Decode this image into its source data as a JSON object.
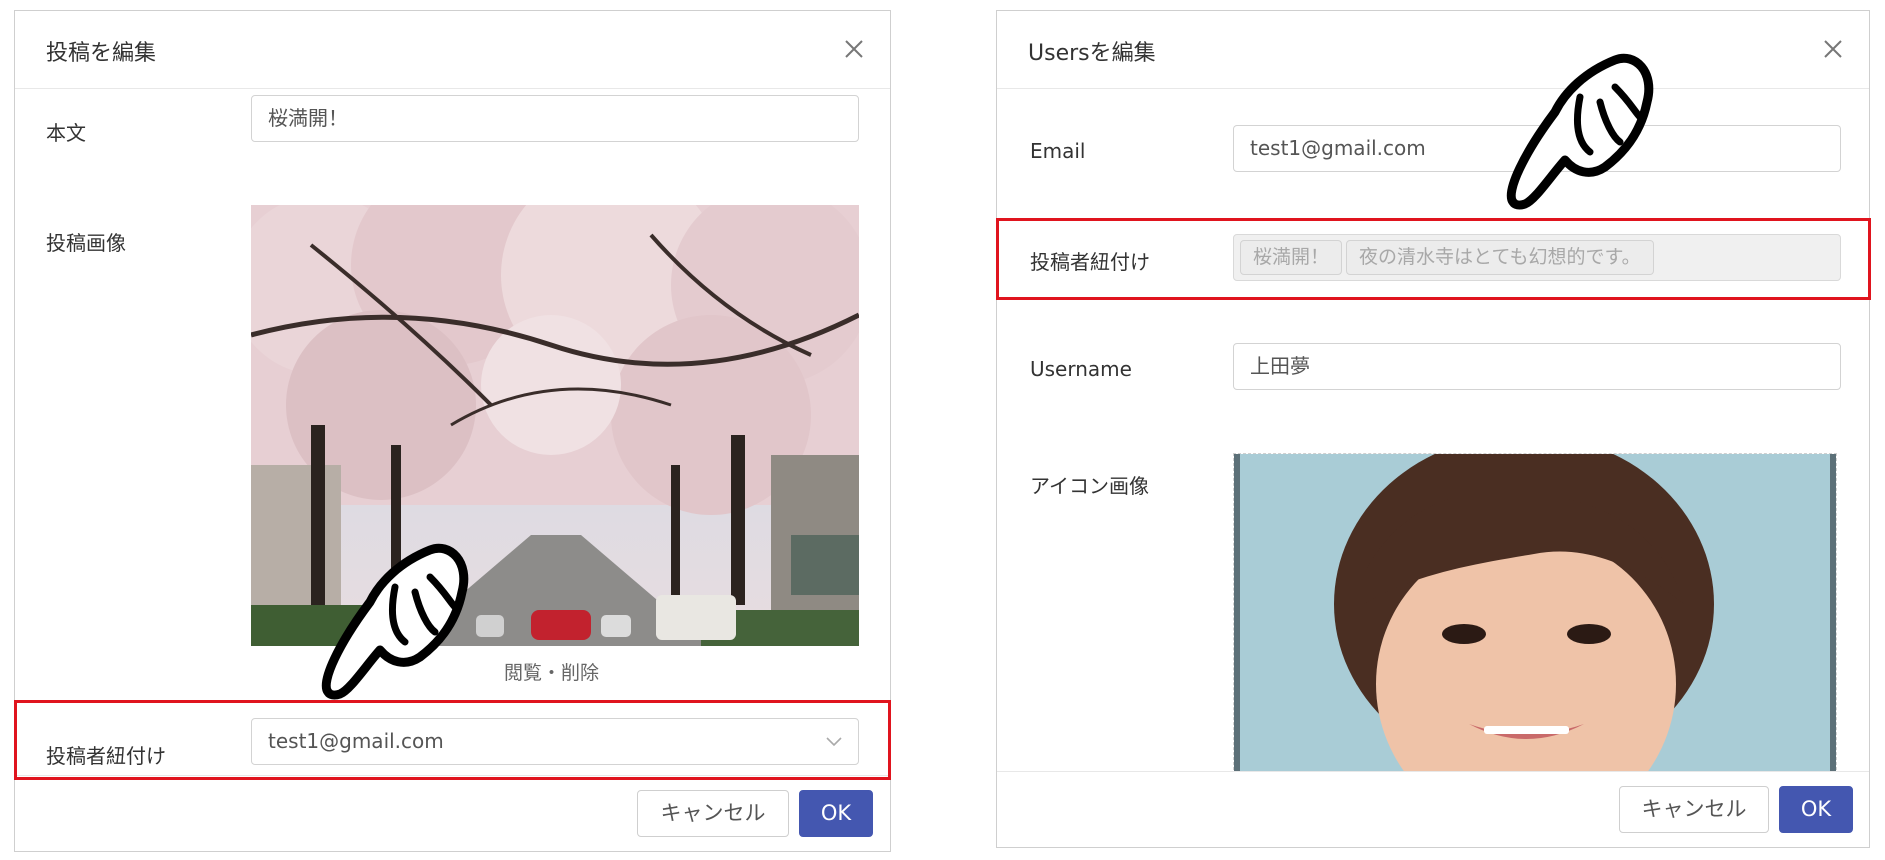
{
  "left_modal": {
    "title": "投稿を編集",
    "fields": {
      "body_label": "本文",
      "body_value": "桜満開！",
      "image_label": "投稿画像",
      "image_action": "閲覧・削除",
      "author_label": "投稿者紐付け",
      "author_value": "test1@gmail.com"
    },
    "cancel_label": "キャンセル",
    "ok_label": "OK"
  },
  "right_modal": {
    "title": "Usersを編集",
    "fields": {
      "email_label": "Email",
      "email_value": "test1@gmail.com",
      "posts_label": "投稿者紐付け",
      "posts_tags": [
        "桜満開！",
        "夜の清水寺はとても幻想的です。"
      ],
      "username_label": "Username",
      "username_value": "上田夢",
      "icon_label": "アイコン画像"
    },
    "cancel_label": "キャンセル",
    "ok_label": "OK"
  },
  "icons": {
    "close": "close-icon",
    "chevron": "chevron-down-icon",
    "pointer": "pointing-hand-icon"
  },
  "colors": {
    "highlight": "#e0141e",
    "primary": "#4457b0"
  }
}
